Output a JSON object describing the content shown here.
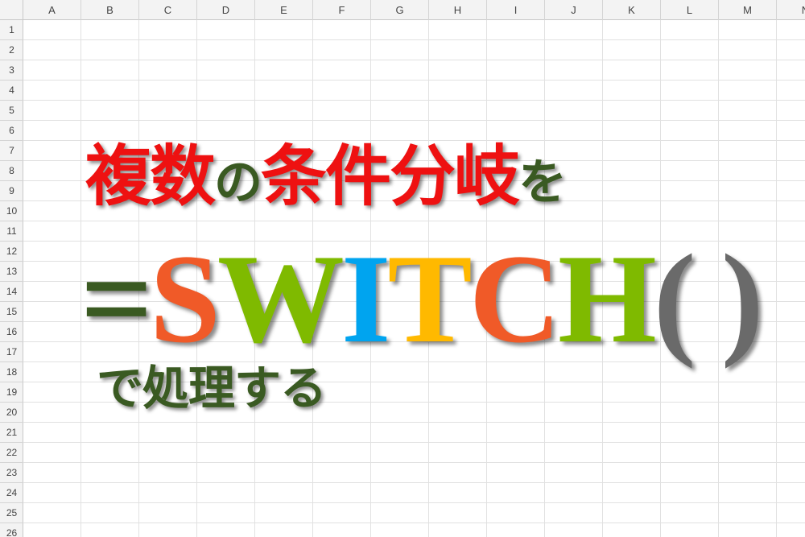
{
  "columns": [
    "A",
    "B",
    "C",
    "D",
    "E",
    "F",
    "G",
    "H",
    "I",
    "J",
    "K",
    "L",
    "M",
    "N"
  ],
  "rows": [
    "1",
    "2",
    "3",
    "4",
    "5",
    "6",
    "7",
    "8",
    "9",
    "10",
    "11",
    "12",
    "13",
    "14",
    "15",
    "16",
    "17",
    "18",
    "19",
    "20",
    "21",
    "22",
    "23",
    "24",
    "25",
    "26"
  ],
  "title": {
    "line1": [
      {
        "text": "複数",
        "style": "big"
      },
      {
        "text": "の",
        "style": "small"
      },
      {
        "text": "条件分岐",
        "style": "big"
      },
      {
        "text": "を",
        "style": "small"
      }
    ],
    "line2": [
      {
        "text": "=",
        "color": "#3a5a22"
      },
      {
        "text": "S",
        "color": "#f05a28"
      },
      {
        "text": "W",
        "color": "#7fba00"
      },
      {
        "text": "I",
        "color": "#00a4ef"
      },
      {
        "text": "T",
        "color": "#ffb900"
      },
      {
        "text": "C",
        "color": "#f05a28"
      },
      {
        "text": "H",
        "color": "#7fba00"
      },
      {
        "text": "( )",
        "color": "#6a6a6a"
      }
    ],
    "line3": "で処理する"
  },
  "colors": {
    "header_bg": "#f3f3f3",
    "gridline": "#e1e1e1",
    "accent_red": "#ee1111",
    "accent_green": "#3a5a22"
  }
}
